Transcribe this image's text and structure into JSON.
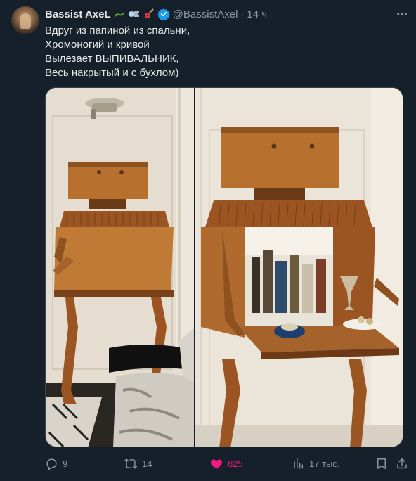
{
  "tweet": {
    "author_name": "Bassist AxeL",
    "handle": "@BassistAxel",
    "separator": "·",
    "time": "14 ч",
    "text_lines": [
      "Вдруг из папиной из спальни,",
      "Хромоногий и кривой",
      "Вылезает ВЫПИВАЛЬНИК,",
      "Весь накрытый и с бухлом)"
    ],
    "name_emojis": [
      "lizard-emoji",
      "wind-emoji",
      "guitar-emoji"
    ],
    "verified_icon": "verified-badge-icon"
  },
  "actions": {
    "replies": "9",
    "reposts": "14",
    "likes": "625",
    "views": "17 тыс."
  },
  "colors": {
    "background": "#15202b",
    "text": "#e7e9ea",
    "muted": "#8b98a5",
    "like": "#f91880",
    "verified": "#1d9bf0"
  }
}
